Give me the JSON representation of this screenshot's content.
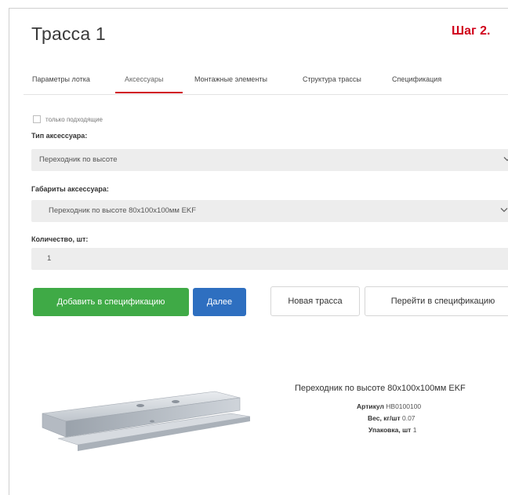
{
  "header": {
    "title": "Трасса 1",
    "step": "Шаг 2."
  },
  "tabs": [
    {
      "label": "Параметры лотка",
      "active": false
    },
    {
      "label": "Аксессуары",
      "active": true
    },
    {
      "label": "Монтажные элементы",
      "active": false
    },
    {
      "label": "Структура трассы",
      "active": false
    },
    {
      "label": "Спецификация",
      "active": false
    }
  ],
  "form": {
    "checkbox_label": "только подходящие",
    "checkbox_checked": false,
    "accessory_type_label": "Тип аксессуара:",
    "accessory_type_value": "Переходник по высоте",
    "accessory_size_label": "Габариты аксессуара:",
    "accessory_size_value": "Переходник по высоте 80х100х100мм EKF",
    "quantity_label": "Количество, шт:",
    "quantity_value": "1"
  },
  "buttons": {
    "add_to_spec": "Добавить в спецификацию",
    "next": "Далее",
    "new_route": "Новая трасса",
    "go_to_spec": "Перейти в спецификацию"
  },
  "product": {
    "name": "Переходник по высоте 80х100х100мм EKF",
    "article_label": "Артикул",
    "article_value": "HB0100100",
    "weight_label": "Вес, кг/шт",
    "weight_value": "0.07",
    "package_label": "Упаковка, шт",
    "package_value": "1"
  },
  "colors": {
    "accent_red": "#d0021b",
    "green_button": "#3faa46",
    "blue_button": "#2e6fc0"
  }
}
